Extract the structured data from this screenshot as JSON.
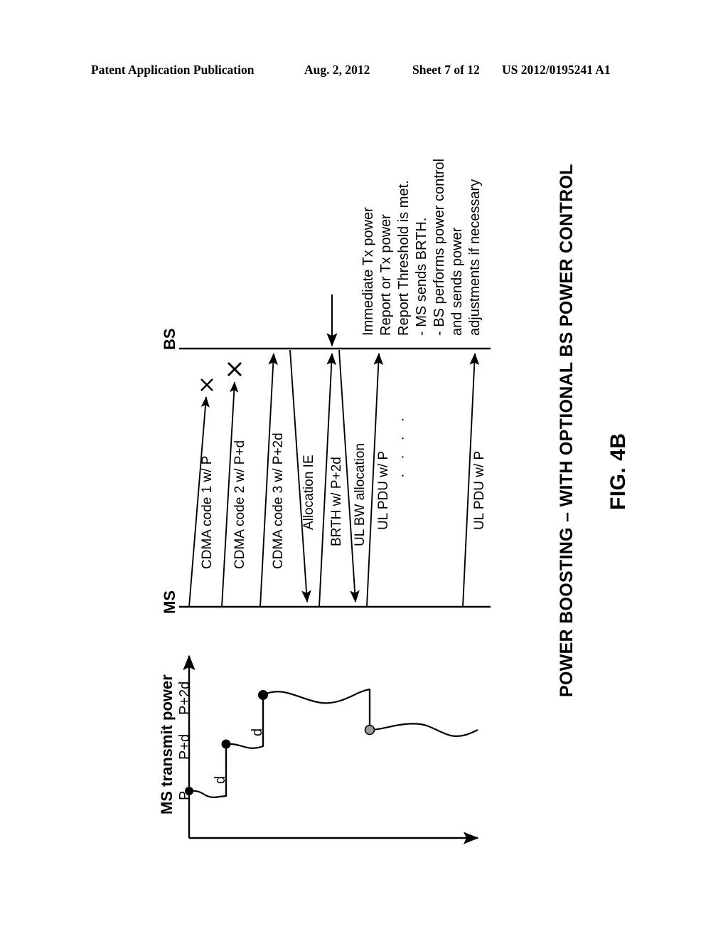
{
  "header": {
    "publication": "Patent Application Publication",
    "date": "Aug. 2, 2012",
    "sheet": "Sheet 7 of 12",
    "patent_number": "US 2012/0195241 A1"
  },
  "figure": {
    "number": "FIG. 4B",
    "title": "POWER BOOSTING – WITH OPTIONAL BS POWER CONTROL"
  },
  "sequence": {
    "actors": {
      "mobile_station": "MS",
      "base_station": "BS"
    },
    "messages": [
      {
        "label": "CDMA code 1 w/ P",
        "direction": "ms-to-bs",
        "delivered": false,
        "failure_marker": "x"
      },
      {
        "label": "CDMA code 2 w/ P+d",
        "direction": "ms-to-bs",
        "delivered": false,
        "failure_marker": "x"
      },
      {
        "label": "CDMA code 3 w/ P+2d",
        "direction": "ms-to-bs",
        "delivered": true,
        "failure_marker": ""
      },
      {
        "label": "Allocation IE",
        "direction": "bs-to-ms",
        "delivered": true,
        "failure_marker": ""
      },
      {
        "label": "BRTH w/ P+2d",
        "direction": "ms-to-bs",
        "delivered": true,
        "failure_marker": ""
      },
      {
        "label": "UL BW allocation",
        "direction": "bs-to-ms",
        "delivered": true,
        "failure_marker": ""
      },
      {
        "label": "UL PDU w/ P",
        "direction": "ms-to-bs",
        "delivered": true,
        "failure_marker": ""
      },
      {
        "label": "UL PDU w/ P",
        "direction": "ms-to-bs",
        "delivered": true,
        "failure_marker": ""
      }
    ],
    "continuation_dots": "· · · ·",
    "annotation": {
      "lines": [
        "Immediate Tx power",
        "Report or Tx power",
        "Report Threshold is met.",
        "- MS sends BRTH.",
        "- BS performs power control",
        "and sends power",
        "adjustments if necessary"
      ]
    }
  },
  "chart_data": {
    "type": "line",
    "title": "",
    "xlabel": "",
    "ylabel": "MS transmit power",
    "ytick_labels": [
      "P",
      "P+d",
      "P+2d"
    ],
    "ytick_values": [
      0,
      1,
      2
    ],
    "ylim": [
      -0.9,
      2.6
    ],
    "xlim": [
      0,
      10
    ],
    "grid": false,
    "legend": null,
    "step_annotations": [
      "d",
      "d"
    ],
    "markers": [
      {
        "label": "P",
        "x": 0.0,
        "y": 0,
        "style": "filled"
      },
      {
        "label": "P+d",
        "x": 2.05,
        "y": 1,
        "style": "filled"
      },
      {
        "label": "P+2d",
        "x": 3.45,
        "y": 2,
        "style": "filled"
      },
      {
        "label": "drop",
        "x": 7.1,
        "y": 1.32,
        "style": "hollow"
      }
    ],
    "series": [
      {
        "name": "MS transmit power",
        "x": [
          0.0,
          0.35,
          0.75,
          1.25,
          1.7,
          2.05,
          2.05,
          2.4,
          2.85,
          3.25,
          3.45,
          3.45,
          3.8,
          4.3,
          4.9,
          5.5,
          6.1,
          6.65,
          7.1,
          7.1,
          7.45,
          7.95,
          8.4,
          8.85,
          9.3,
          9.75,
          10.0
        ],
        "y": [
          0.0,
          0.02,
          -0.08,
          -0.06,
          0.0,
          0.0,
          1.0,
          1.02,
          0.96,
          0.95,
          0.95,
          2.0,
          2.1,
          2.08,
          1.92,
          1.88,
          1.95,
          2.06,
          2.06,
          1.32,
          1.33,
          1.4,
          1.5,
          1.45,
          1.3,
          1.32,
          1.42
        ]
      }
    ]
  }
}
